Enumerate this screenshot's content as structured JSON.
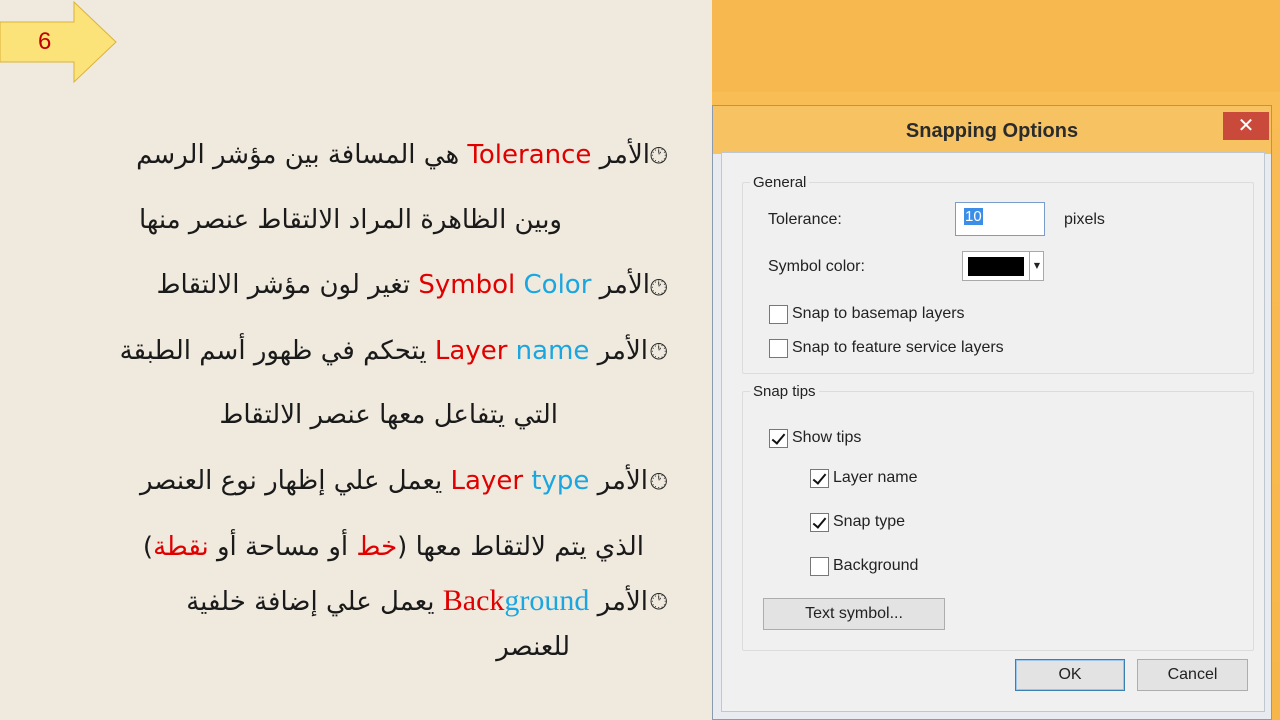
{
  "slide": {
    "number": "6",
    "lines": [
      {
        "pre": "الأمر ",
        "term": "Tolerance",
        "post": " هي المسافة بين مؤشر الرسم"
      },
      {
        "text": "وبين الظاهرة المراد الالتقاط عنصر منها"
      },
      {
        "pre": "الأمر ",
        "term1": "Symbol",
        "term2": "Color",
        "post": " تغير لون مؤشر الالتقاط"
      },
      {
        "pre": "الأمر ",
        "term1": "Layer",
        "term2": "name",
        "post": " يتحكم في ظهور أسم الطبقة"
      },
      {
        "text": "التي يتفاعل معها عنصر الالتقاط"
      },
      {
        "pre": "الأمر ",
        "term1": "Layer",
        "term2": "type",
        "post": " يعمل علي إظهار نوع العنصر"
      },
      {
        "pre": "الذي يتم لالتقاط معها (",
        "red1": "خط",
        "mid": "أو مساحة أو ",
        "red2": "نقطة",
        "post": ")"
      },
      {
        "pre": "الأمر ",
        "term1": "Back",
        "term2": "ground",
        "post": " يعمل علي إضافة خلفية"
      },
      {
        "text": "للعنصر"
      }
    ],
    "bullet_icon": "clock-icon"
  },
  "dialog": {
    "title": "Snapping Options",
    "close_glyph": "✕",
    "general": {
      "title": "General",
      "tolerance_label": "Tolerance:",
      "tolerance_value": "10",
      "tolerance_unit": "pixels",
      "symbol_color_label": "Symbol color:",
      "symbol_color": "#000000",
      "snap_basemap": {
        "label": "Snap to basemap layers",
        "checked": false
      },
      "snap_feature": {
        "label": "Snap to feature service layers",
        "checked": false
      }
    },
    "snap_tips": {
      "title": "Snap tips",
      "show_tips": {
        "label": "Show tips",
        "checked": true
      },
      "layer_name": {
        "label": "Layer name",
        "checked": true
      },
      "snap_type": {
        "label": "Snap type",
        "checked": true
      },
      "background": {
        "label": "Background",
        "checked": false
      },
      "text_symbol_button": "Text symbol..."
    },
    "ok_label": "OK",
    "cancel_label": "Cancel"
  }
}
